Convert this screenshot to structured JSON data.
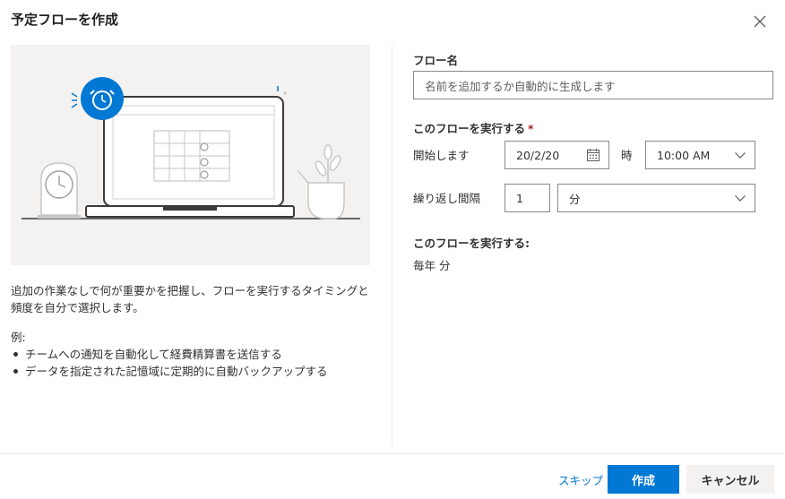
{
  "dialog": {
    "title": "予定フローを作成"
  },
  "left": {
    "description": "追加の作業なしで何が重要かを把握し、フローを実行するタイミングと頻度を自分で選択します。",
    "example_label": "例:",
    "examples": [
      "チームへの通知を自動化して経費精算書を送信する",
      "データを指定された記憶域に定期的に自動バックアップする"
    ]
  },
  "form": {
    "flow_name_label": "フロー名",
    "flow_name_placeholder": "名前を追加するか自動的に生成します",
    "run_label": "このフローを実行する",
    "required_mark": "*",
    "start_label": "開始します",
    "start_date": "20/2/20",
    "time_label": "時",
    "start_time": "10:00 AM",
    "repeat_label": "繰り返し間隔",
    "repeat_value": "1",
    "repeat_unit": "分",
    "summary_label": "このフローを実行する:",
    "summary_value": "毎年 分"
  },
  "footer": {
    "skip": "スキップ",
    "create": "作成",
    "cancel": "キャンセル"
  },
  "colors": {
    "accent": "#0078d4",
    "required": "#a4262c",
    "illustration_bg": "#f3f2f1"
  }
}
